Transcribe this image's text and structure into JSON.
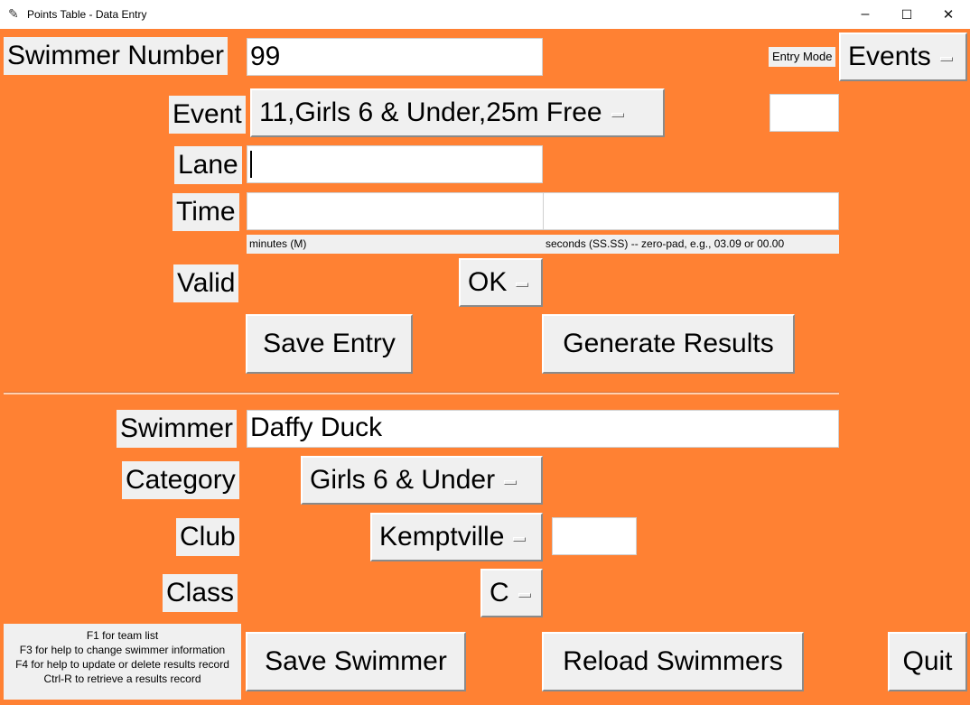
{
  "window": {
    "title": "Points Table - Data Entry",
    "icon": "feather-icon",
    "controls": {
      "minimize": "–",
      "maximize": "☐",
      "close": "✕"
    }
  },
  "entry_section": {
    "swimmer_number_label": "Swimmer Number",
    "swimmer_number_value": "99",
    "entry_mode_label": "Entry Mode",
    "events_menu": "Events",
    "event_label": "Event",
    "event_value": "11,Girls 6 & Under,25m Free",
    "event_extra_value": "",
    "lane_label": "Lane",
    "lane_value": "",
    "time_label": "Time",
    "minutes_value": "",
    "seconds_value": "",
    "minutes_hint": "minutes (M)",
    "seconds_hint": "seconds (SS.SS) -- zero-pad, e.g., 03.09 or 00.00",
    "valid_label": "Valid",
    "valid_value": "OK",
    "save_entry": "Save Entry",
    "generate_results": "Generate Results"
  },
  "swimmer_section": {
    "swimmer_label": "Swimmer",
    "swimmer_value": "Daffy Duck",
    "category_label": "Category",
    "category_value": "Girls 6 & Under",
    "club_label": "Club",
    "club_value": "Kemptville",
    "club_extra_value": "",
    "class_label": "Class",
    "class_value": "C",
    "save_swimmer": "Save Swimmer",
    "reload_swimmers": "Reload Swimmers",
    "quit": "Quit"
  },
  "help": {
    "line1": "F1 for team list",
    "line2": "F3 for help to change swimmer information",
    "line3": "F4 for help to update or delete results record",
    "line4": "Ctrl-R to retrieve a results record"
  },
  "colors": {
    "background": "#ff8133",
    "widget": "#f0f0f0",
    "entry": "#ffffff"
  }
}
